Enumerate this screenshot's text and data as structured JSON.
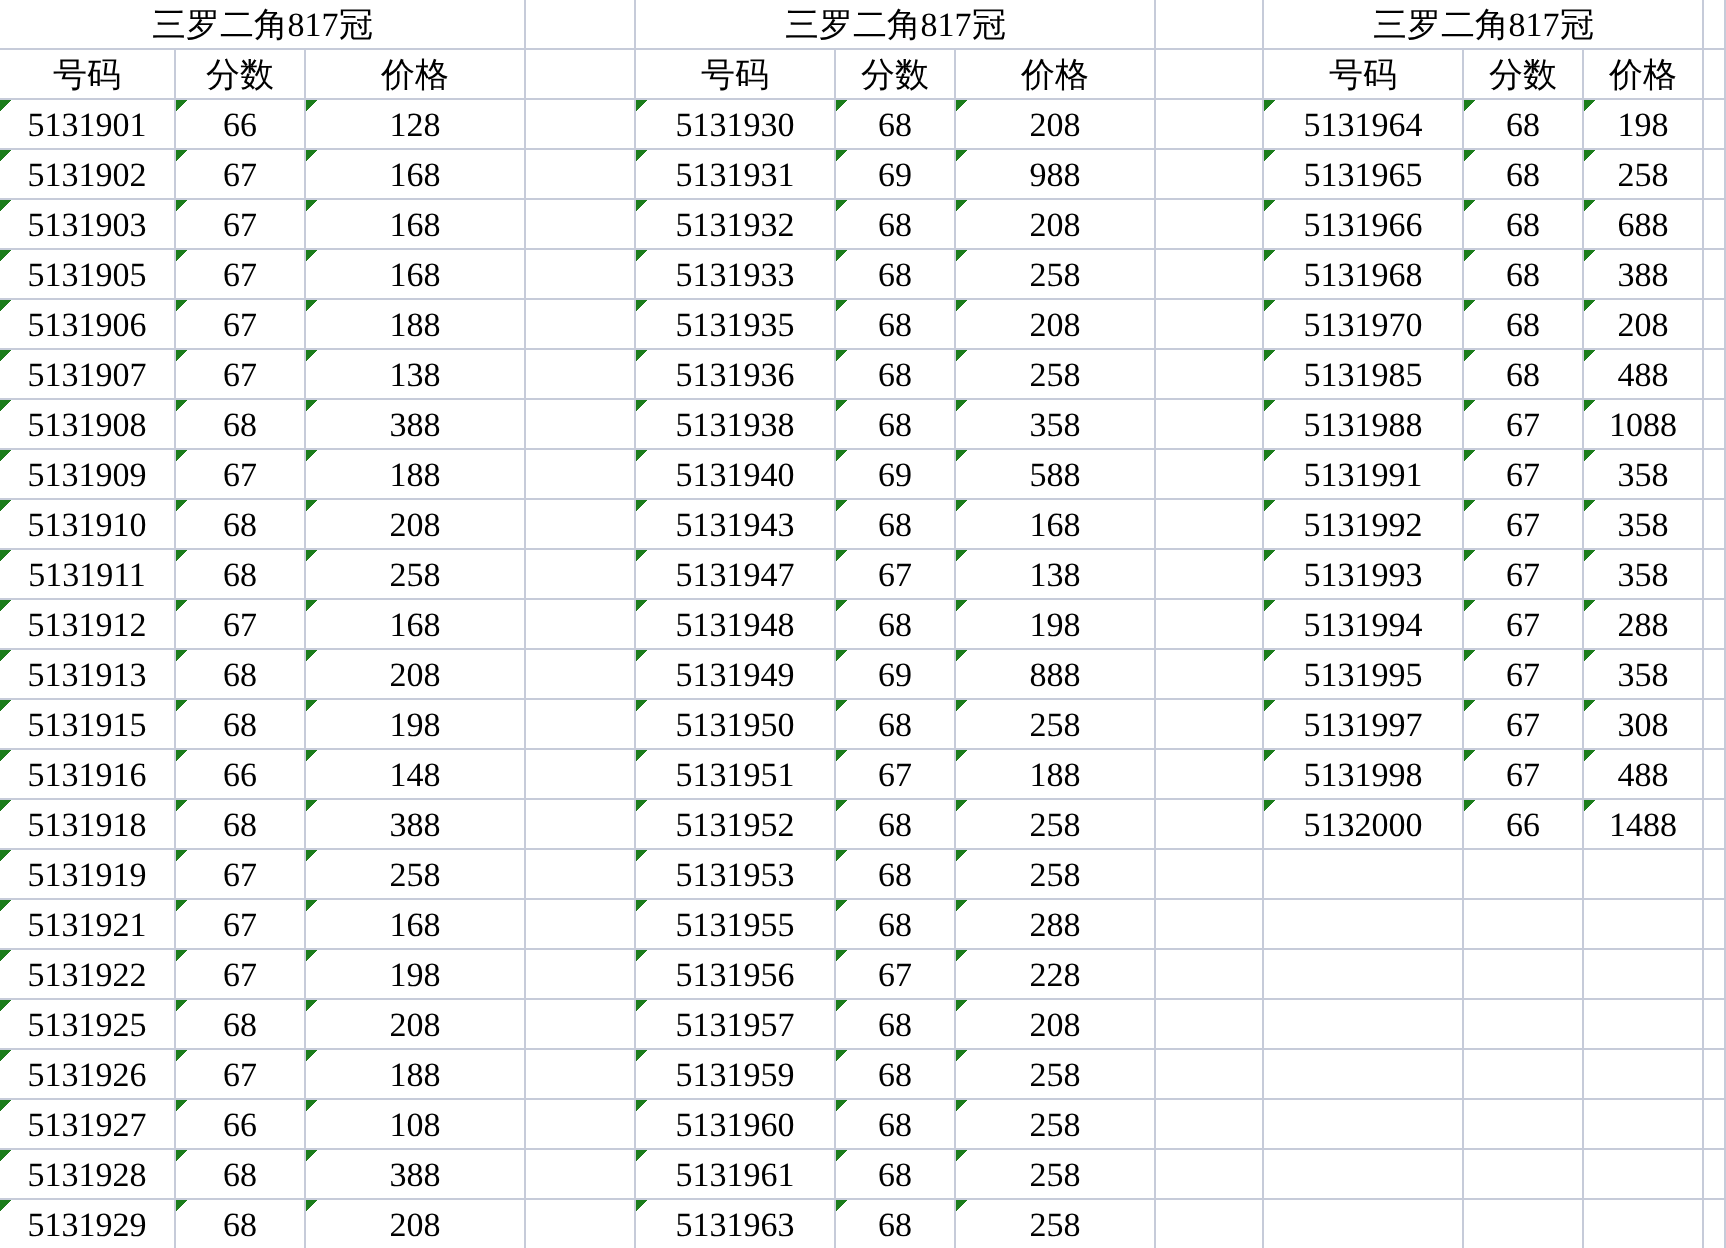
{
  "groups": [
    {
      "title": "三罗二角817冠",
      "columns": [
        "号码",
        "分数",
        "价格"
      ],
      "rows": [
        [
          "5131901",
          "66",
          "128"
        ],
        [
          "5131902",
          "67",
          "168"
        ],
        [
          "5131903",
          "67",
          "168"
        ],
        [
          "5131905",
          "67",
          "168"
        ],
        [
          "5131906",
          "67",
          "188"
        ],
        [
          "5131907",
          "67",
          "138"
        ],
        [
          "5131908",
          "68",
          "388"
        ],
        [
          "5131909",
          "67",
          "188"
        ],
        [
          "5131910",
          "68",
          "208"
        ],
        [
          "5131911",
          "68",
          "258"
        ],
        [
          "5131912",
          "67",
          "168"
        ],
        [
          "5131913",
          "68",
          "208"
        ],
        [
          "5131915",
          "68",
          "198"
        ],
        [
          "5131916",
          "66",
          "148"
        ],
        [
          "5131918",
          "68",
          "388"
        ],
        [
          "5131919",
          "67",
          "258"
        ],
        [
          "5131921",
          "67",
          "168"
        ],
        [
          "5131922",
          "67",
          "198"
        ],
        [
          "5131925",
          "68",
          "208"
        ],
        [
          "5131926",
          "67",
          "188"
        ],
        [
          "5131927",
          "66",
          "108"
        ],
        [
          "5131928",
          "68",
          "388"
        ],
        [
          "5131929",
          "68",
          "208"
        ]
      ]
    },
    {
      "title": "三罗二角817冠",
      "columns": [
        "号码",
        "分数",
        "价格"
      ],
      "rows": [
        [
          "5131930",
          "68",
          "208"
        ],
        [
          "5131931",
          "69",
          "988"
        ],
        [
          "5131932",
          "68",
          "208"
        ],
        [
          "5131933",
          "68",
          "258"
        ],
        [
          "5131935",
          "68",
          "208"
        ],
        [
          "5131936",
          "68",
          "258"
        ],
        [
          "5131938",
          "68",
          "358"
        ],
        [
          "5131940",
          "69",
          "588"
        ],
        [
          "5131943",
          "68",
          "168"
        ],
        [
          "5131947",
          "67",
          "138"
        ],
        [
          "5131948",
          "68",
          "198"
        ],
        [
          "5131949",
          "69",
          "888"
        ],
        [
          "5131950",
          "68",
          "258"
        ],
        [
          "5131951",
          "67",
          "188"
        ],
        [
          "5131952",
          "68",
          "258"
        ],
        [
          "5131953",
          "68",
          "258"
        ],
        [
          "5131955",
          "68",
          "288"
        ],
        [
          "5131956",
          "67",
          "228"
        ],
        [
          "5131957",
          "68",
          "208"
        ],
        [
          "5131959",
          "68",
          "258"
        ],
        [
          "5131960",
          "68",
          "258"
        ],
        [
          "5131961",
          "68",
          "258"
        ],
        [
          "5131963",
          "68",
          "258"
        ]
      ]
    },
    {
      "title": "三罗二角817冠",
      "columns": [
        "号码",
        "分数",
        "价格"
      ],
      "rows": [
        [
          "5131964",
          "68",
          "198"
        ],
        [
          "5131965",
          "68",
          "258"
        ],
        [
          "5131966",
          "68",
          "688"
        ],
        [
          "5131968",
          "68",
          "388"
        ],
        [
          "5131970",
          "68",
          "208"
        ],
        [
          "5131985",
          "68",
          "488"
        ],
        [
          "5131988",
          "67",
          "1088"
        ],
        [
          "5131991",
          "67",
          "358"
        ],
        [
          "5131992",
          "67",
          "358"
        ],
        [
          "5131993",
          "67",
          "358"
        ],
        [
          "5131994",
          "67",
          "288"
        ],
        [
          "5131995",
          "67",
          "358"
        ],
        [
          "5131997",
          "67",
          "308"
        ],
        [
          "5131998",
          "67",
          "488"
        ],
        [
          "5132000",
          "66",
          "1488"
        ]
      ]
    }
  ]
}
